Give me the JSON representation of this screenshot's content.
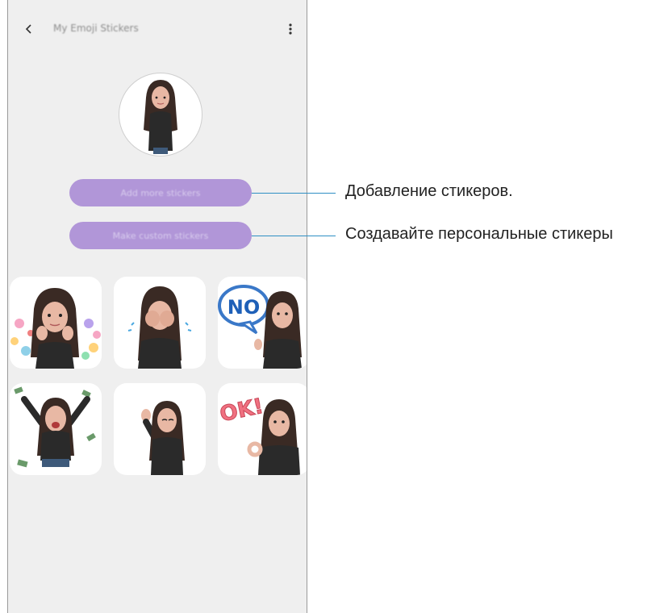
{
  "header": {
    "title": "My Emoji Stickers",
    "back_icon": "chevron-left-icon",
    "more_icon": "more-vertical-icon"
  },
  "buttons": {
    "add_more": "Add more stickers",
    "make_custom": "Make custom stickers"
  },
  "stickers": [
    {
      "name": "hearts-sticker"
    },
    {
      "name": "crying-sticker"
    },
    {
      "name": "no-sticker",
      "text": "NO"
    },
    {
      "name": "money-sticker"
    },
    {
      "name": "wave-sticker"
    },
    {
      "name": "ok-sticker",
      "text": "OK!"
    }
  ],
  "callouts": {
    "add": "Добавление стикеров.",
    "custom": "Создавайте персональные стикеры"
  },
  "colors": {
    "button": "#b196d8",
    "callout_line": "#2f8fc4",
    "background": "#efefef"
  }
}
